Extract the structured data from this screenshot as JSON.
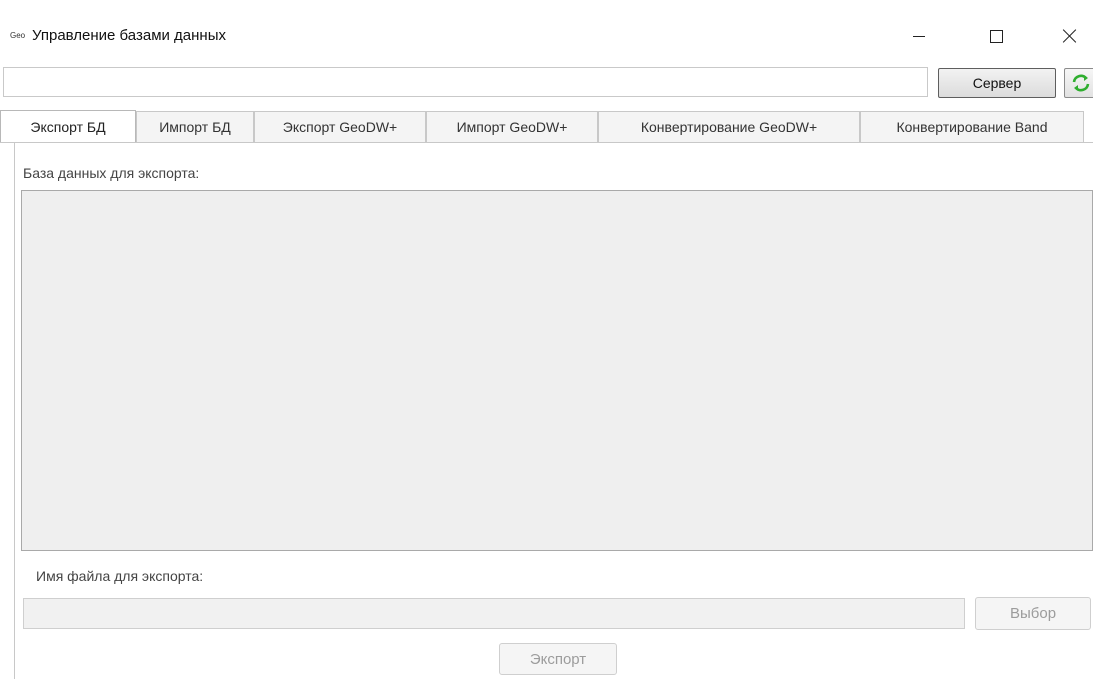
{
  "window": {
    "icon_text": "Geo",
    "title": "Управление базами данных"
  },
  "toolbar": {
    "server_value": "",
    "server_button": "Сервер",
    "refresh_icon": "refresh-icon",
    "refresh_color": "#2fae2f"
  },
  "tabs": [
    {
      "label": "Экспорт БД",
      "active": true
    },
    {
      "label": "Импорт БД",
      "active": false
    },
    {
      "label": "Экспорт GeoDW+",
      "active": false
    },
    {
      "label": "Импорт GeoDW+",
      "active": false
    },
    {
      "label": "Конвертирование GeoDW+",
      "active": false
    },
    {
      "label": "Конвертирование Band",
      "active": false
    }
  ],
  "export": {
    "db_label": "База данных для экспорта:",
    "file_label": "Имя файла для экспорта:",
    "file_value": "",
    "pick_button": "Выбор",
    "export_button": "Экспорт"
  }
}
